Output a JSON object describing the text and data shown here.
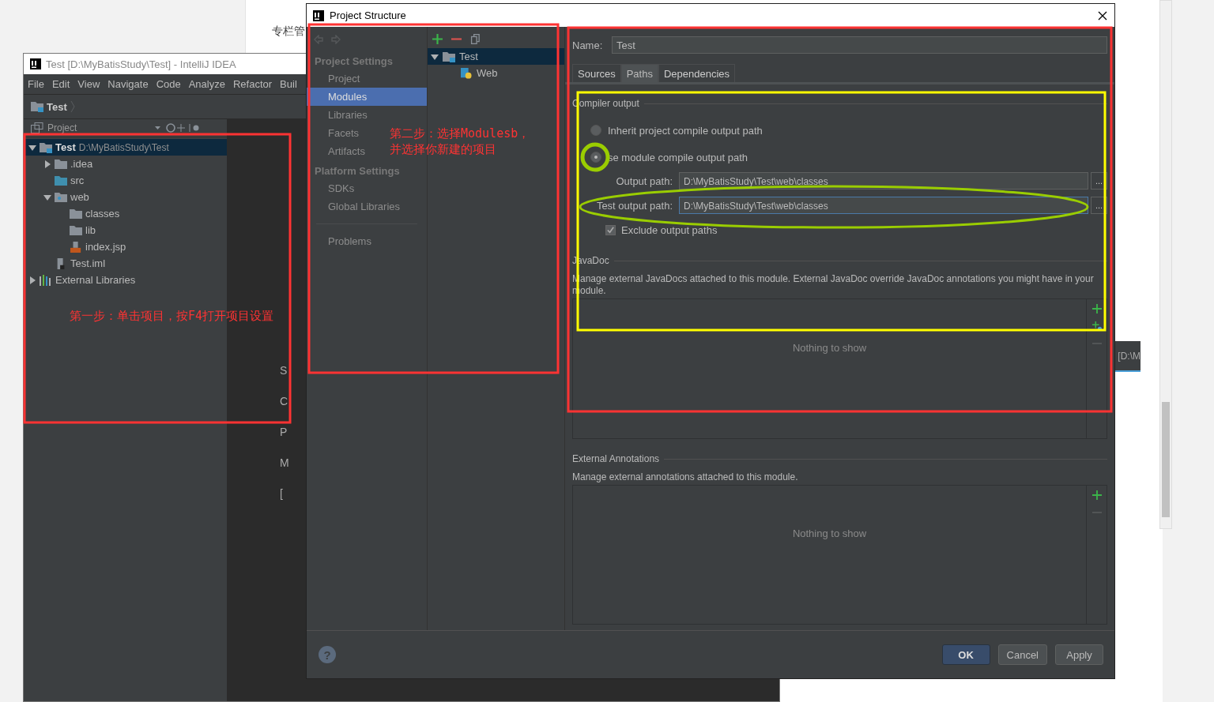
{
  "background": {
    "page_fragment": "专栏管",
    "editor_fragments": [
      "S",
      "C",
      "P",
      "M",
      "["
    ],
    "side_tab_fragment": "[D:\\M"
  },
  "ide": {
    "title": "Test [D:\\MyBatisStudy\\Test] - IntelliJ IDEA",
    "menu": [
      "File",
      "Edit",
      "View",
      "Navigate",
      "Code",
      "Analyze",
      "Refactor",
      "Buil"
    ],
    "breadcrumb": "Test",
    "panel_title": "Project",
    "tree": [
      {
        "label": "Test",
        "path": "D:\\MyBatisStudy\\Test",
        "kind": "module",
        "expanded": true,
        "selected": true,
        "children": [
          {
            "label": ".idea",
            "kind": "folder",
            "expanded": false,
            "selected": false
          },
          {
            "label": "src",
            "kind": "source-folder",
            "selected": false
          },
          {
            "label": "web",
            "kind": "web-folder",
            "expanded": true,
            "selected": false,
            "children": [
              {
                "label": "classes",
                "kind": "folder",
                "selected": false
              },
              {
                "label": "lib",
                "kind": "folder",
                "selected": false
              },
              {
                "label": "index.jsp",
                "kind": "jsp",
                "selected": false
              }
            ]
          },
          {
            "label": "Test.iml",
            "kind": "iml",
            "selected": false
          }
        ]
      },
      {
        "label": "External Libraries",
        "kind": "libraries",
        "expanded": false,
        "selected": false
      }
    ]
  },
  "dialog": {
    "title": "Project Structure",
    "nav": [
      {
        "heading": "Project Settings",
        "items": [
          {
            "label": "Project",
            "selected": false
          },
          {
            "label": "Modules",
            "selected": true
          },
          {
            "label": "Libraries",
            "selected": false
          },
          {
            "label": "Facets",
            "selected": false
          },
          {
            "label": "Artifacts",
            "selected": false
          }
        ]
      },
      {
        "heading": "Platform Settings",
        "items": [
          {
            "label": "SDKs",
            "selected": false
          },
          {
            "label": "Global Libraries",
            "selected": false
          }
        ]
      },
      {
        "items": [
          {
            "label": "Problems",
            "selected": false
          }
        ]
      }
    ],
    "modules": [
      {
        "label": "Test",
        "kind": "module",
        "expanded": true,
        "selected": true,
        "children": [
          {
            "label": "Web",
            "kind": "web-facet",
            "selected": false
          }
        ]
      }
    ],
    "name_label": "Name:",
    "name_value": "Test",
    "tabs": [
      {
        "label": "Sources",
        "selected": false
      },
      {
        "label": "Paths",
        "selected": true
      },
      {
        "label": "Dependencies",
        "selected": false
      }
    ],
    "compiler_output": {
      "title": "Compiler output",
      "options": [
        {
          "label": "Inherit project compile output path",
          "selected": false
        },
        {
          "label": "se module compile output path",
          "selected": true
        }
      ],
      "paths": [
        {
          "label": "Output path:",
          "value": "D:\\MyBatisStudy\\Test\\web\\classes",
          "focused": false,
          "browse": "..."
        },
        {
          "label": "Test output path:",
          "value": "D:\\MyBatisStudy\\Test\\web\\classes",
          "focused": true,
          "browse": "..."
        }
      ],
      "exclude": {
        "label": "Exclude output paths",
        "checked": true
      }
    },
    "javadoc": {
      "title": "JavaDoc",
      "description": "Manage external JavaDocs attached to this module. External JavaDoc override JavaDoc annotations you might have in your module.",
      "empty_text": "Nothing to show",
      "tools": [
        {
          "kind": "add",
          "disabled": false
        },
        {
          "kind": "add-url",
          "disabled": false
        },
        {
          "kind": "remove",
          "disabled": true
        }
      ]
    },
    "external_annotations": {
      "title": "External Annotations",
      "description": "Manage external annotations attached to this module.",
      "empty_text": "Nothing to show",
      "tools": [
        {
          "kind": "add",
          "disabled": false
        },
        {
          "kind": "remove",
          "disabled": true
        }
      ]
    },
    "help": "?",
    "buttons": [
      {
        "label": "OK",
        "default": true
      },
      {
        "label": "Cancel",
        "default": false
      },
      {
        "label": "Apply",
        "default": false
      }
    ]
  },
  "annotations": [
    {
      "lines": [
        "第一步：单击项目，按F4打开项目设置"
      ]
    },
    {
      "lines": [
        "第二步：选择Modulesb，",
        "并选择你新建的项目"
      ]
    }
  ]
}
